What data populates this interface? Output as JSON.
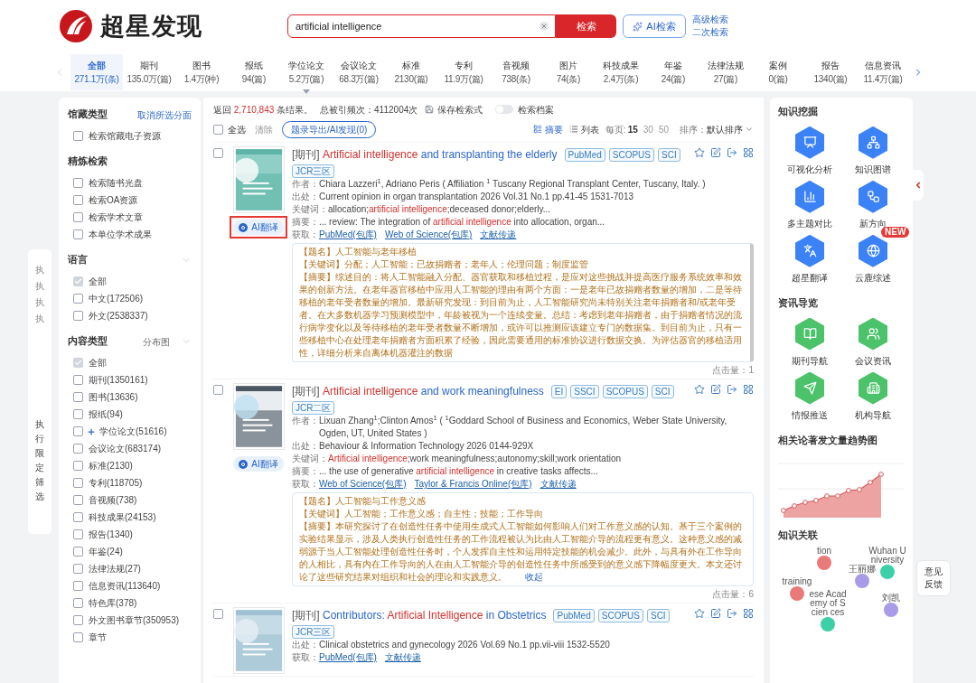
{
  "header": {
    "logo_text": "超星发现",
    "search": {
      "value": "artificial intelligence"
    },
    "search_button": "检索",
    "ai_button": "AI检索",
    "links": [
      "高级检索",
      "二次检索"
    ]
  },
  "tabs": [
    {
      "label": "全部",
      "count": "271.1万(条)",
      "selected": true,
      "dropdown": false
    },
    {
      "label": "期刊",
      "count": "135.0万(篇)",
      "selected": false,
      "dropdown": false
    },
    {
      "label": "图书",
      "count": "1.4万(种)",
      "selected": false,
      "dropdown": false
    },
    {
      "label": "报纸",
      "count": "94(篇)",
      "selected": false,
      "dropdown": false
    },
    {
      "label": "学位论文",
      "count": "5.2万(篇)",
      "selected": false,
      "dropdown": true
    },
    {
      "label": "会议论文",
      "count": "68.3万(篇)",
      "selected": false,
      "dropdown": false
    },
    {
      "label": "标准",
      "count": "2130(篇)",
      "selected": false,
      "dropdown": false
    },
    {
      "label": "专利",
      "count": "11.9万(篇)",
      "selected": false,
      "dropdown": false
    },
    {
      "label": "音视频",
      "count": "738(条)",
      "selected": false,
      "dropdown": false
    },
    {
      "label": "图片",
      "count": "74(条)",
      "selected": false,
      "dropdown": false
    },
    {
      "label": "科技成果",
      "count": "2.4万(条)",
      "selected": false,
      "dropdown": false
    },
    {
      "label": "年鉴",
      "count": "24(篇)",
      "selected": false,
      "dropdown": false
    },
    {
      "label": "法律法规",
      "count": "27(篇)",
      "selected": false,
      "dropdown": false
    },
    {
      "label": "案例",
      "count": "0(篇)",
      "selected": false,
      "dropdown": false
    },
    {
      "label": "报告",
      "count": "1340(篇)",
      "selected": false,
      "dropdown": false
    },
    {
      "label": "信息资讯",
      "count": "11.4万(篇)",
      "selected": false,
      "dropdown": false
    }
  ],
  "side_strip": {
    "ghost_chars": [
      "执",
      "执",
      "执",
      "执"
    ],
    "label": "执行限定筛选"
  },
  "sidebar": [
    {
      "title": "馆藏类型",
      "kind": "plain",
      "action": "取消所选分面",
      "options": [
        {
          "label": "检索馆藏电子资源",
          "checked": false,
          "expandable": false
        }
      ]
    },
    {
      "title": "精炼检索",
      "kind": "plain",
      "options": [
        {
          "label": "检索随书光盘",
          "checked": false,
          "expandable": false
        },
        {
          "label": "检索OA资源",
          "checked": false,
          "expandable": false
        },
        {
          "label": "检索学术文章",
          "checked": false,
          "expandable": false
        },
        {
          "label": "本单位学术成果",
          "checked": false,
          "expandable": false
        }
      ]
    },
    {
      "title": "语言",
      "kind": "collapsible",
      "options": [
        {
          "label": "全部",
          "checked": true,
          "expandable": false
        },
        {
          "label": "中文(172506)",
          "checked": false,
          "expandable": false
        },
        {
          "label": "外文(2538337)",
          "checked": false,
          "expandable": false
        }
      ]
    },
    {
      "title": "内容类型",
      "kind": "collapsible",
      "extra": "分布图",
      "options": [
        {
          "label": "全部",
          "checked": true,
          "expandable": false
        },
        {
          "label": "期刊(1350161)",
          "checked": false,
          "expandable": false
        },
        {
          "label": "图书(13636)",
          "checked": false,
          "expandable": false
        },
        {
          "label": "报纸(94)",
          "checked": false,
          "expandable": false
        },
        {
          "label": "学位论文(51616)",
          "checked": false,
          "expandable": true
        },
        {
          "label": "会议论文(683174)",
          "checked": false,
          "expandable": false
        },
        {
          "label": "标准(2130)",
          "checked": false,
          "expandable": false
        },
        {
          "label": "专利(118705)",
          "checked": false,
          "expandable": false
        },
        {
          "label": "音视频(738)",
          "checked": false,
          "expandable": false
        },
        {
          "label": "科技成果(24153)",
          "checked": false,
          "expandable": false
        },
        {
          "label": "报告(1340)",
          "checked": false,
          "expandable": false
        },
        {
          "label": "年鉴(24)",
          "checked": false,
          "expandable": false
        },
        {
          "label": "法律法规(27)",
          "checked": false,
          "expandable": false
        },
        {
          "label": "信息资讯(113640)",
          "checked": false,
          "expandable": false
        },
        {
          "label": "特色库(378)",
          "checked": false,
          "expandable": false
        },
        {
          "label": "外文图书章节(350953)",
          "checked": false,
          "expandable": false
        },
        {
          "label": "章节",
          "checked": false,
          "expandable": false
        }
      ]
    }
  ],
  "summary": {
    "prefix": "返回",
    "count": "2,710,843",
    "suffix": "条结果。",
    "citations": "总被引频次：4112004次",
    "save": "保存检索式",
    "archive": {
      "label": "检索档案",
      "on": false
    }
  },
  "toolbar": {
    "select_all": {
      "label": "全选",
      "checked": false
    },
    "clear": "清除",
    "export": "题录导出/AI发现(0)",
    "views": [
      {
        "label": "摘要",
        "selected": true
      },
      {
        "label": "列表",
        "selected": false
      }
    ],
    "per_page_label": "每页:",
    "per_page": [
      {
        "label": "15",
        "selected": true
      },
      {
        "label": "30",
        "selected": false
      },
      {
        "label": "50",
        "selected": false
      }
    ],
    "sort_label": "排序：",
    "sort": "默认排序"
  },
  "records": [
    {
      "checked": false,
      "type": "[期刊]",
      "title": [
        {
          "text": "Artificial intelligence",
          "highlight": true
        },
        {
          "text": " and transplanting the elderly",
          "highlight": false
        }
      ],
      "badges": [
        "PubMed",
        "SCOPUS",
        "SCI",
        "JCR三区"
      ],
      "ai_button": {
        "label": "AI翻译",
        "highlighted": true
      },
      "fields": [
        {
          "kind": "text",
          "label": "作者：",
          "parts": [
            {
              "text": "Chiara Lazzeri$^{1}$, Adriano Peris ( Affiliation $^{1}$ Tuscany Regional Transplant Center, Tuscany, Italy. )",
              "highlight": false
            }
          ]
        },
        {
          "kind": "text",
          "label": "出处：",
          "parts": [
            {
              "text": "Current opinion in organ transplantation 2026 Vol.31 No.1 pp.41-45 1531-7013",
              "highlight": false
            }
          ]
        },
        {
          "kind": "text",
          "label": "关键词：",
          "parts": [
            {
              "text": "allocation;",
              "highlight": false
            },
            {
              "text": "artificial intelligence",
              "highlight": true
            },
            {
              "text": ";deceased donor;elderly...",
              "highlight": false
            }
          ]
        },
        {
          "kind": "text",
          "label": "摘要：",
          "parts": [
            {
              "text": "... review: The integration of ",
              "highlight": false
            },
            {
              "text": "artificial intelligence",
              "highlight": true
            },
            {
              "text": " into allocation, organ...",
              "highlight": false
            }
          ]
        },
        {
          "kind": "links",
          "label": "获取：",
          "links": [
            "PubMed(包库)",
            "Web of Science(包库)",
            "文献传递"
          ]
        }
      ],
      "translation": {
        "scrollable": true,
        "lines": [
          {
            "label": "【题名】",
            "text": "人工智能与老年移植"
          },
          {
            "label": "【关键词】",
            "text": "分配；人工智能；已故捐赠者；老年人；伦理问题；制度监管"
          },
          {
            "label": "【摘要】",
            "text": "综述目的：将人工智能融入分配、器官获取和移植过程，是应对这些挑战并提高医疗服务系统效率和效果的创新方法。在老年器官移植中应用人工智能的理由有两个方面：一是老年已故捐赠者数量的增加，二是等待移植的老年受者数量的增加。最新研究发现：到目前为止，人工智能研究尚未特别关注老年捐赠者和/或老年受者。在大多数机器学习预测模型中，年龄被视为一个连续变量。总结：考虑到老年捐赠者，由于捐赠者情况的流行病学变化以及等待移植的老年受者数量不断增加，或许可以推测应该建立专门的数据集。到目前为止，只有一些移植中心在处理老年捐赠者方面积累了经验，因此需要通用的标准协议进行数据交换。为评估器官的移植适用性，详细分析来自离体机器灌注的数据"
          }
        ]
      },
      "clicks": "点击量：1"
    },
    {
      "checked": false,
      "type": "[期刊]",
      "title": [
        {
          "text": "Artificial intelligence",
          "highlight": true
        },
        {
          "text": " and work meaningfulness",
          "highlight": false
        }
      ],
      "badges": [
        "EI",
        "SSCI",
        "SCOPUS",
        "SCI",
        "JCR二区"
      ],
      "ai_button": {
        "label": "AI翻译",
        "highlighted": false
      },
      "fields": [
        {
          "kind": "text",
          "label": "作者：",
          "parts": [
            {
              "text": "Lixuan Zhang$^{1}$;Clinton Amos$^{1}$ ( $^{1}$Goddard School of Business and Economics, Weber State University, Ogden, UT, United States )",
              "highlight": false
            }
          ]
        },
        {
          "kind": "text",
          "label": "出处：",
          "parts": [
            {
              "text": "Behaviour & Information Technology 2026  0144-929X",
              "highlight": false
            }
          ]
        },
        {
          "kind": "text",
          "label": "关键词：",
          "parts": [
            {
              "text": "Artificial intelligence",
              "highlight": true
            },
            {
              "text": ";work meaningfulness;autonomy;skill;work orientation",
              "highlight": false
            }
          ]
        },
        {
          "kind": "text",
          "label": "摘要：",
          "parts": [
            {
              "text": "... the use of generative ",
              "highlight": false
            },
            {
              "text": "artificial intelligence",
              "highlight": true
            },
            {
              "text": " in creative tasks affects...",
              "highlight": false
            }
          ]
        },
        {
          "kind": "links",
          "label": "获取：",
          "links": [
            "Web of Science(包库)",
            "Taylor & Francis Online(包库)",
            "文献传递"
          ]
        }
      ],
      "translation": {
        "scrollable": false,
        "lines": [
          {
            "label": "【题名】",
            "text": "人工智能与工作意义感"
          },
          {
            "label": "【关键词】",
            "text": "人工智能；工作意义感；自主性；技能；工作导向"
          },
          {
            "label": "【摘要】",
            "text": "本研究探讨了在创造性任务中使用生成式人工智能如何影响人们对工作意义感的认知。基于三个案例的实验结果显示，涉及人类执行创造性任务的工作流程被认为比由人工智能介导的流程更有意义。这种意义感的减弱源于当人工智能处理创造性任务时，个人发挥自主性和运用特定技能的机会减少。此外，与具有外在工作导向的人相比，具有内在工作导向的人在由人工智能介导的创造性任务中所感受到的意义感下降幅度更大。本文还讨论了这些研究结果对组织和社会的理论和实践意义。"
          }
        ],
        "collapse": "收起"
      },
      "clicks": "点击量：6"
    },
    {
      "checked": false,
      "type": "[期刊]",
      "title": [
        {
          "text": "Contributors: ",
          "highlight": false
        },
        {
          "text": "Artificial Intelligence",
          "highlight": true
        },
        {
          "text": " in Obstetrics",
          "highlight": false
        }
      ],
      "badges": [
        "PubMed",
        "SCOPUS",
        "SCI",
        "JCR三区"
      ],
      "fields": [
        {
          "kind": "text",
          "label": "出处：",
          "parts": [
            {
              "text": "Clinical obstetrics and gynecology 2026 Vol.69 No.1 pp.vii-viii 1532-5520",
              "highlight": false
            }
          ]
        },
        {
          "kind": "links",
          "label": "获取：",
          "links": [
            "PubMed(包库)",
            "文献传递"
          ]
        }
      ]
    }
  ],
  "right_panel": {
    "tool_sections": [
      {
        "title": "知识挖掘",
        "color": "#3b82f6",
        "tools": [
          {
            "label": "可视化分析"
          },
          {
            "label": "知识图谱"
          },
          {
            "label": "多主题对比"
          },
          {
            "label": "新方向"
          },
          {
            "label": "超星翻译"
          },
          {
            "label": "云鹿综述",
            "badge": "NEW"
          }
        ]
      },
      {
        "title": "资讯导览",
        "color": "#4cc26a",
        "tools": [
          {
            "label": "期刊导航"
          },
          {
            "label": "会议资讯"
          },
          {
            "label": "情报推送"
          },
          {
            "label": "机构导航"
          }
        ]
      }
    ],
    "trend_title": "相关论著发文量趋势图",
    "graph_title": "知识关联",
    "graph_nodes": [
      {
        "label": "tion",
        "color": "#e87a7a"
      },
      {
        "label": "training",
        "color": "#e87a7a"
      },
      {
        "label": "ese Academy of Scien ces",
        "color": "#3ccfa8"
      },
      {
        "label": "王丽娜",
        "color": "#a99be8"
      },
      {
        "label": "Wuhan University",
        "color": "#3ccfa8"
      },
      {
        "label": "刘凯",
        "color": "#a99be8"
      }
    ]
  },
  "feedback": "意见反馈"
}
